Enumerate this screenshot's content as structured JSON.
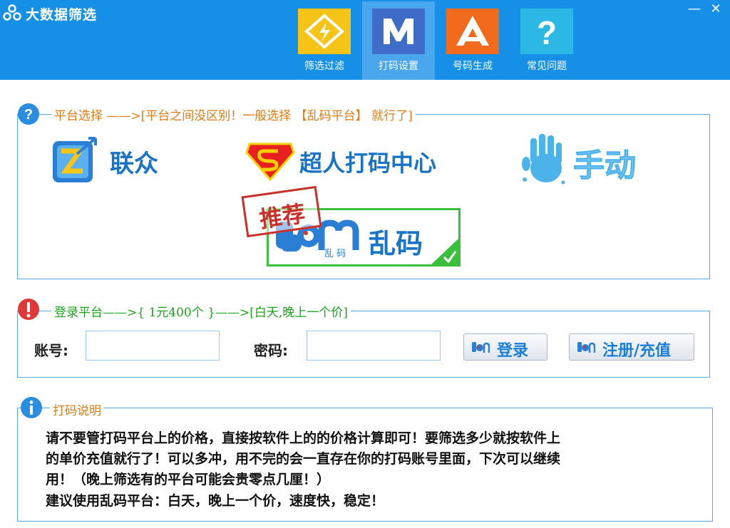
{
  "window": {
    "title": "大数据筛选",
    "minimize_glyph": "—",
    "close_glyph": "✕"
  },
  "tabs": [
    {
      "label": "筛选过滤",
      "icon": "lightning-icon",
      "color": "#f6c417"
    },
    {
      "label": "打码设置",
      "icon": "m-letter-icon",
      "color": "#3f6cc9",
      "active": true
    },
    {
      "label": "号码生成",
      "icon": "a-letter-icon",
      "color": "#f26a1b"
    },
    {
      "label": "常见问题",
      "icon": "question-icon",
      "color": "#2cb8e4"
    }
  ],
  "platform_section": {
    "title": "平台选择 ——>[平台之间没区别！一般选择 【乱码平台】 就行了]",
    "title_color": "#e07a12",
    "platforms": [
      {
        "name": "联众",
        "logo": "lianzhong-logo-icon"
      },
      {
        "name": "超人打码中心",
        "logo": "superman-logo-icon"
      },
      {
        "name": "手动",
        "logo": "hand-print-icon"
      },
      {
        "name": "乱码",
        "logo_sub": "乱 码",
        "stamp": "推荐",
        "logo": "luanma-logo-icon",
        "selected": true
      }
    ]
  },
  "login_section": {
    "title": "登录平台——>{ 1元400个 }——>[白天,晚上一个价]",
    "title_color": "#1aa51a",
    "account_label": "账号:",
    "account_value": "",
    "password_label": "密码:",
    "password_value": "",
    "login_button": "登录",
    "register_button": "注册/充值"
  },
  "notes_section": {
    "title": "打码说明",
    "title_color": "#e07a12",
    "lines": [
      "请不要管打码平台上的价格，直接按软件上的的价格计算即可！要筛选多少就按软件上",
      "的单价充值就行了！可以多冲，用不完的会一直存在你的打码账号里面，下次可以继续",
      "用！（晚上筛选有的平台可能会贵零点几厘！）",
      "建议使用乱码平台：白天，晚上一个价，速度快，稳定！"
    ]
  },
  "colors": {
    "titlebar": "#1590e6",
    "frame_border": "#56a9e8",
    "accent_blue": "#1a74c6"
  }
}
